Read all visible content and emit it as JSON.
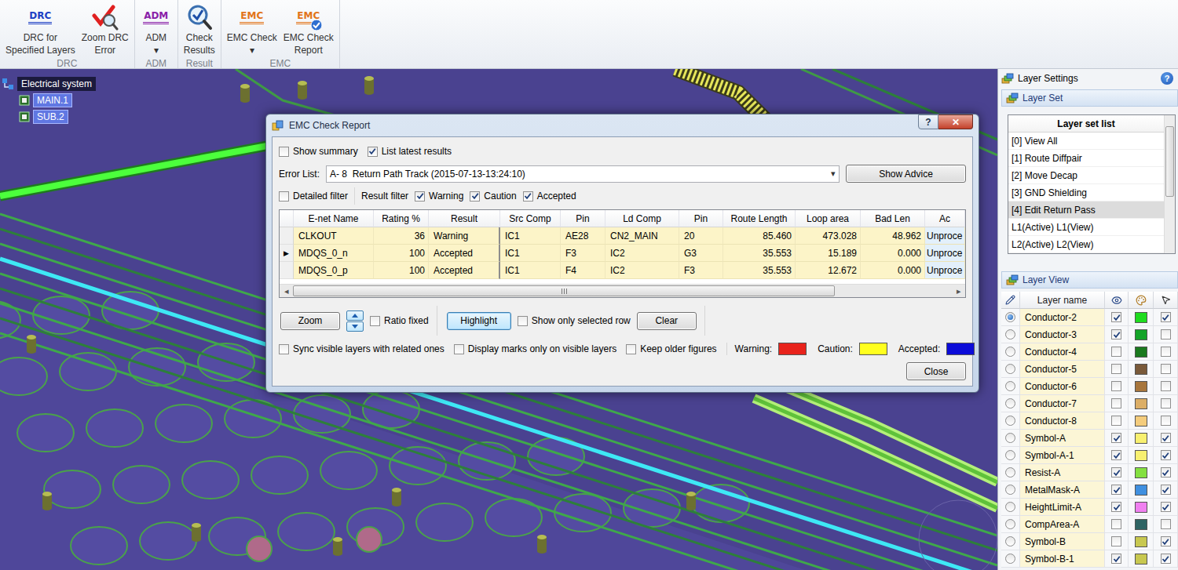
{
  "ribbon": {
    "arrow": "▾",
    "groups": [
      {
        "label": "DRC",
        "buttons": [
          {
            "kind": "badge",
            "badge": "DRC",
            "color": "#1d3fc4",
            "lines": [
              "DRC for",
              "Specified Layers"
            ],
            "dropdown": false
          },
          {
            "kind": "zoom-error",
            "lines": [
              "Zoom DRC",
              "Error"
            ],
            "dropdown": false
          }
        ]
      },
      {
        "label": "ADM",
        "buttons": [
          {
            "kind": "badge",
            "badge": "ADM",
            "color": "#8a1fa8",
            "lines": [
              "ADM"
            ],
            "dropdown": true
          }
        ]
      },
      {
        "label": "Result",
        "buttons": [
          {
            "kind": "check-results",
            "lines": [
              "Check",
              "Results"
            ],
            "dropdown": false
          }
        ]
      },
      {
        "label": "EMC",
        "buttons": [
          {
            "kind": "badge",
            "badge": "EMC",
            "color": "#e2741a",
            "lines": [
              "EMC Check"
            ],
            "dropdown": true
          },
          {
            "kind": "badge-report",
            "badge": "EMC",
            "color": "#e2741a",
            "lines": [
              "EMC Check",
              "Report"
            ],
            "dropdown": false
          }
        ]
      }
    ]
  },
  "tree": {
    "root": "Electrical system",
    "children": [
      "MAIN.1",
      "SUB.2"
    ]
  },
  "dialog": {
    "title": "EMC Check Report",
    "help": "?",
    "close": "✕",
    "options": [
      {
        "label": "Show summary",
        "checked": false
      },
      {
        "label": "List latest results",
        "checked": true
      }
    ],
    "error_list": {
      "label": "Error List:",
      "value": "A- 8  Return Path Track (2015-07-13-13:24:10)",
      "arrow": "▾"
    },
    "show_advice": "Show Advice",
    "detailed_filter": {
      "label": "Detailed filter",
      "checked": false
    },
    "result_filter": {
      "label": "Result filter",
      "items": [
        {
          "label": "Warning",
          "checked": true
        },
        {
          "label": "Caution",
          "checked": true
        },
        {
          "label": "Accepted",
          "checked": true
        }
      ]
    },
    "table": {
      "marker": "▶",
      "columns": [
        "E-net Name",
        "Rating %",
        "Result",
        "Src Comp",
        "Pin",
        "Ld Comp",
        "Pin",
        "Route Length",
        "Loop area",
        "Bad Len",
        "Ac"
      ],
      "rows": [
        {
          "selected": false,
          "cells": [
            "CLKOUT",
            "36",
            "Warning",
            "IC1",
            "AE28",
            "CN2_MAIN",
            "20",
            "85.460",
            "473.028",
            "48.962",
            "Unproce"
          ]
        },
        {
          "selected": true,
          "cells": [
            "MDQS_0_n",
            "100",
            "Accepted",
            "IC1",
            "F3",
            "IC2",
            "G3",
            "35.553",
            "15.189",
            "0.000",
            "Unproce"
          ]
        },
        {
          "selected": false,
          "cells": [
            "MDQS_0_p",
            "100",
            "Accepted",
            "IC1",
            "F4",
            "IC2",
            "F3",
            "35.553",
            "12.672",
            "0.000",
            "Unproce"
          ]
        }
      ]
    },
    "scrollbar": {
      "left": "◂",
      "right": "▸"
    },
    "zoom": "Zoom",
    "ratio_fixed": {
      "label": "Ratio fixed",
      "checked": false
    },
    "highlight": {
      "label": "Highlight",
      "focused": true
    },
    "show_only_selected": {
      "label": "Show only selected row",
      "checked": false
    },
    "clear": "Clear",
    "view_options": [
      {
        "label": "Sync visible layers with related ones",
        "checked": false
      },
      {
        "label": "Display marks only on visible layers",
        "checked": false
      },
      {
        "label": "Keep older figures",
        "checked": false
      }
    ],
    "legend": [
      {
        "label": "Warning:",
        "color": "#e8231c"
      },
      {
        "label": "Caution:",
        "color": "#ffff1e"
      },
      {
        "label": "Accepted:",
        "color": "#0c0cd8"
      }
    ],
    "close_button": "Close"
  },
  "layer_panel": {
    "title": "Layer Settings",
    "help": "?",
    "layer_set": {
      "title": "Layer Set",
      "header": "Layer set list",
      "items": [
        {
          "label": "[0] View All",
          "selected": false
        },
        {
          "label": "[1] Route Diffpair",
          "selected": false
        },
        {
          "label": "[2] Move Decap",
          "selected": false
        },
        {
          "label": "[3] GND Shielding",
          "selected": false
        },
        {
          "label": "[4] Edit Return Pass",
          "selected": true
        },
        {
          "label": "L1(Active) L1(View)",
          "selected": false
        },
        {
          "label": "L2(Active) L2(View)",
          "selected": false
        }
      ]
    },
    "layer_view": {
      "title": "Layer View",
      "name_column": "Layer name",
      "rows": [
        {
          "name": "Conductor-2",
          "active": true,
          "visible": true,
          "color": "#1fdc1f",
          "selectable": true
        },
        {
          "name": "Conductor-3",
          "active": false,
          "visible": true,
          "color": "#14a428",
          "selectable": false
        },
        {
          "name": "Conductor-4",
          "active": false,
          "visible": false,
          "color": "#1b7a1e",
          "selectable": false
        },
        {
          "name": "Conductor-5",
          "active": false,
          "visible": false,
          "color": "#7a5a3a",
          "selectable": false
        },
        {
          "name": "Conductor-6",
          "active": false,
          "visible": false,
          "color": "#a8763c",
          "selectable": false
        },
        {
          "name": "Conductor-7",
          "active": false,
          "visible": false,
          "color": "#dcae66",
          "selectable": false
        },
        {
          "name": "Conductor-8",
          "active": false,
          "visible": false,
          "color": "#f4cc7c",
          "selectable": false
        },
        {
          "name": "Symbol-A",
          "active": false,
          "visible": true,
          "color": "#f8f070",
          "selectable": true
        },
        {
          "name": "Symbol-A-1",
          "active": false,
          "visible": true,
          "color": "#f8f070",
          "selectable": true
        },
        {
          "name": "Resist-A",
          "active": false,
          "visible": true,
          "color": "#84e040",
          "selectable": true
        },
        {
          "name": "MetalMask-A",
          "active": false,
          "visible": true,
          "color": "#4090e0",
          "selectable": true
        },
        {
          "name": "HeightLimit-A",
          "active": false,
          "visible": true,
          "color": "#f080f0",
          "selectable": true
        },
        {
          "name": "CompArea-A",
          "active": false,
          "visible": false,
          "color": "#2f6464",
          "selectable": false
        },
        {
          "name": "Symbol-B",
          "active": false,
          "visible": false,
          "color": "#c8c850",
          "selectable": true
        },
        {
          "name": "Symbol-B-1",
          "active": false,
          "visible": true,
          "color": "#c8c850",
          "selectable": true
        }
      ]
    }
  }
}
